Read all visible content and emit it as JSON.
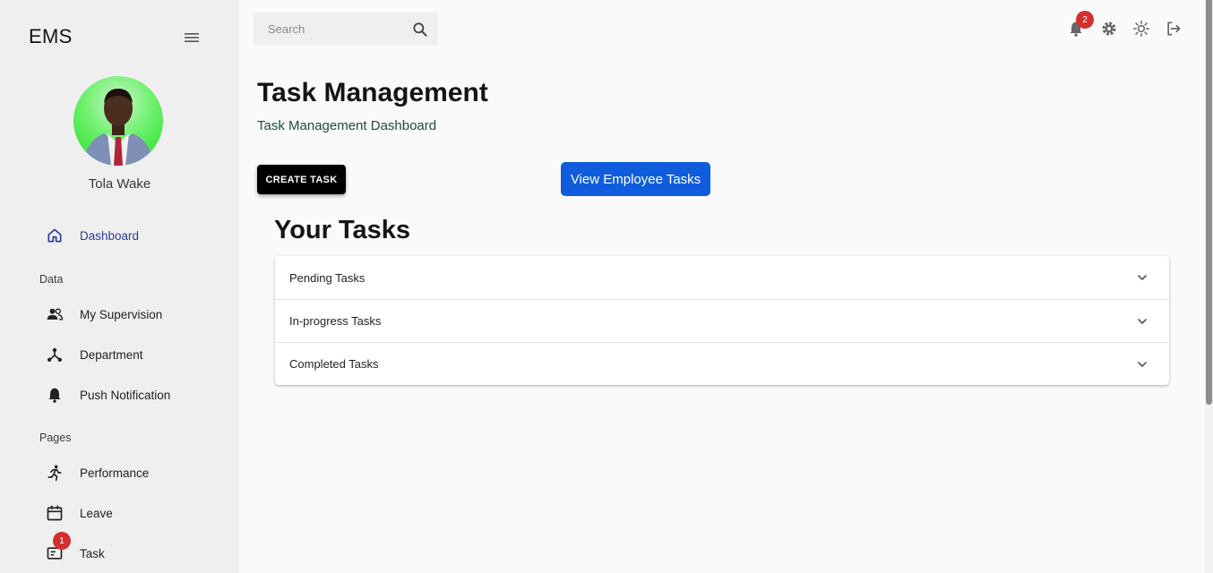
{
  "sidebar": {
    "brand": "EMS",
    "profile": {
      "name": "Tola Wake"
    },
    "nav": {
      "dashboard": "Dashboard",
      "data_section": "Data",
      "my_supervision": "My Supervision",
      "department": "Department",
      "push_notification": "Push Notification",
      "pages_section": "Pages",
      "performance": "Performance",
      "leave": "Leave",
      "task": "Task",
      "task_badge": "1"
    }
  },
  "topbar": {
    "search_placeholder": "Search",
    "notification_count": "2"
  },
  "main": {
    "title": "Task Management",
    "subtitle": "Task Management Dashboard",
    "create_button": "CREATE TASK",
    "view_button": "View Employee Tasks",
    "section_title": "Your Tasks",
    "accordion": [
      {
        "label": "Pending Tasks"
      },
      {
        "label": "In-progress Tasks"
      },
      {
        "label": "Completed Tasks"
      }
    ]
  },
  "colors": {
    "accent_blue": "#0f5ddc",
    "active_nav": "#2b3c97",
    "badge_red": "#d32f2f",
    "sidebar_bg": "#f0eff0"
  },
  "icons": [
    "menu-icon",
    "home-icon",
    "people-icon",
    "hub-icon",
    "bell-icon",
    "run-icon",
    "calendar-icon",
    "task-icon",
    "search-icon",
    "gear-icon",
    "sun-icon",
    "logout-icon",
    "chevron-down-icon"
  ]
}
